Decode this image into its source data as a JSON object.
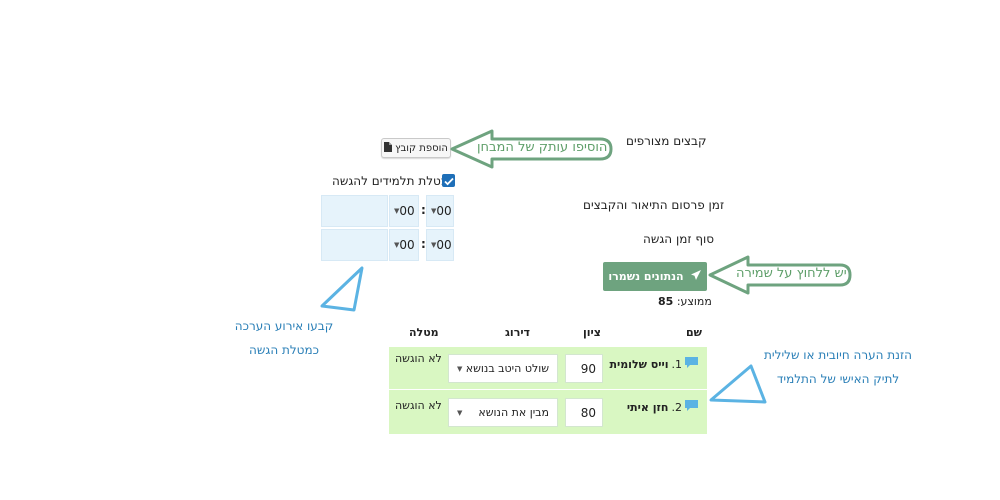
{
  "form": {
    "attachments_label": "קבצים מצורפים",
    "add_file_label": "הוספת קובץ",
    "assignment_task_label": "מטלת תלמידים להגשה",
    "publish_time_label": "זמן פרסום התיאור והקבצים",
    "submit_end_label": "סוף זמן הגשה",
    "publish_time": {
      "hours": "00",
      "minutes": "00"
    },
    "submit_time": {
      "hours": "00",
      "minutes": "00"
    },
    "save_label": "הנתונים נשמרו",
    "average_label": "ממוצע:",
    "average_value": "85"
  },
  "table": {
    "headers": {
      "name": "שם",
      "grade": "ציון",
      "rubric": "דירוג",
      "task": "מטלה"
    },
    "rows": [
      {
        "num": "1.",
        "name": "וייס שלומית",
        "grade": "90",
        "rubric": "שולט היטב בנושא",
        "task": "לא הוגשה"
      },
      {
        "num": "2.",
        "name": "חזן איתי",
        "grade": "80",
        "rubric": "מבין את הנושא",
        "task": "לא הוגשה"
      }
    ]
  },
  "annotations": {
    "add_copy": "הוסיפו עותק של המבחן",
    "press_save": "יש ללחוץ על שמירה",
    "set_event_line1": "קבעו אירוע הערכה",
    "set_event_line2": "כמטלת הגשה",
    "comment_line1": "הזנת הערה חיובית או שלילית",
    "comment_line2": "לתיק האישי של התלמיד"
  },
  "colors": {
    "green_arrow": "#6ea37f",
    "blue_arrow": "#5bb3e3",
    "row_bg": "#d9f7c2",
    "time_bg": "#e6f3fb",
    "save_bg": "#6ea37f"
  }
}
